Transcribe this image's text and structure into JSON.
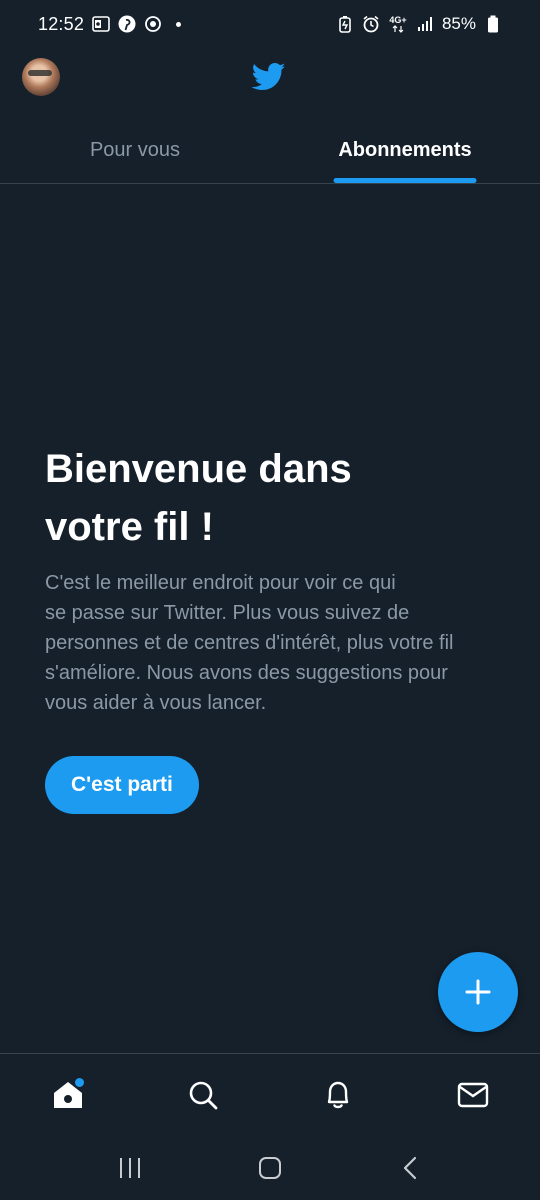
{
  "status_bar": {
    "time": "12:52",
    "network_label": "4G+",
    "battery": "85%",
    "left_icons": [
      "outlook-icon",
      "pinterest-icon",
      "sync-icon"
    ],
    "right_icons": [
      "battery-saver-icon",
      "alarm-icon",
      "network-icon",
      "signal-icon",
      "battery-icon"
    ]
  },
  "header": {
    "logo": "twitter-bird-icon",
    "avatar": "profile-avatar"
  },
  "tabs": [
    {
      "label": "Pour vous",
      "active": false
    },
    {
      "label": "Abonnements",
      "active": true
    }
  ],
  "welcome": {
    "title_line1": "Bienvenue dans",
    "title_line2": "votre fil !",
    "text_line1": "C'est le meilleur endroit pour voir ce qui",
    "text_line2": "se passe sur Twitter. Plus vous suivez de",
    "text_line3": "personnes et de centres d'intérêt, plus votre fil",
    "text_line4": "s'améliore. Nous avons des suggestions pour",
    "text_line5": "vous aider à vous lancer.",
    "button": "C'est parti"
  },
  "fab": {
    "icon": "plus-icon"
  },
  "bottom_nav": [
    "home-icon",
    "search-icon",
    "bell-icon",
    "mail-icon"
  ],
  "system_nav": [
    "recents-icon",
    "home-circle-icon",
    "back-icon"
  ],
  "colors": {
    "background": "#15202b",
    "accent": "#1d9bf0",
    "muted_text": "#8b98a5",
    "divider": "#38444d"
  }
}
